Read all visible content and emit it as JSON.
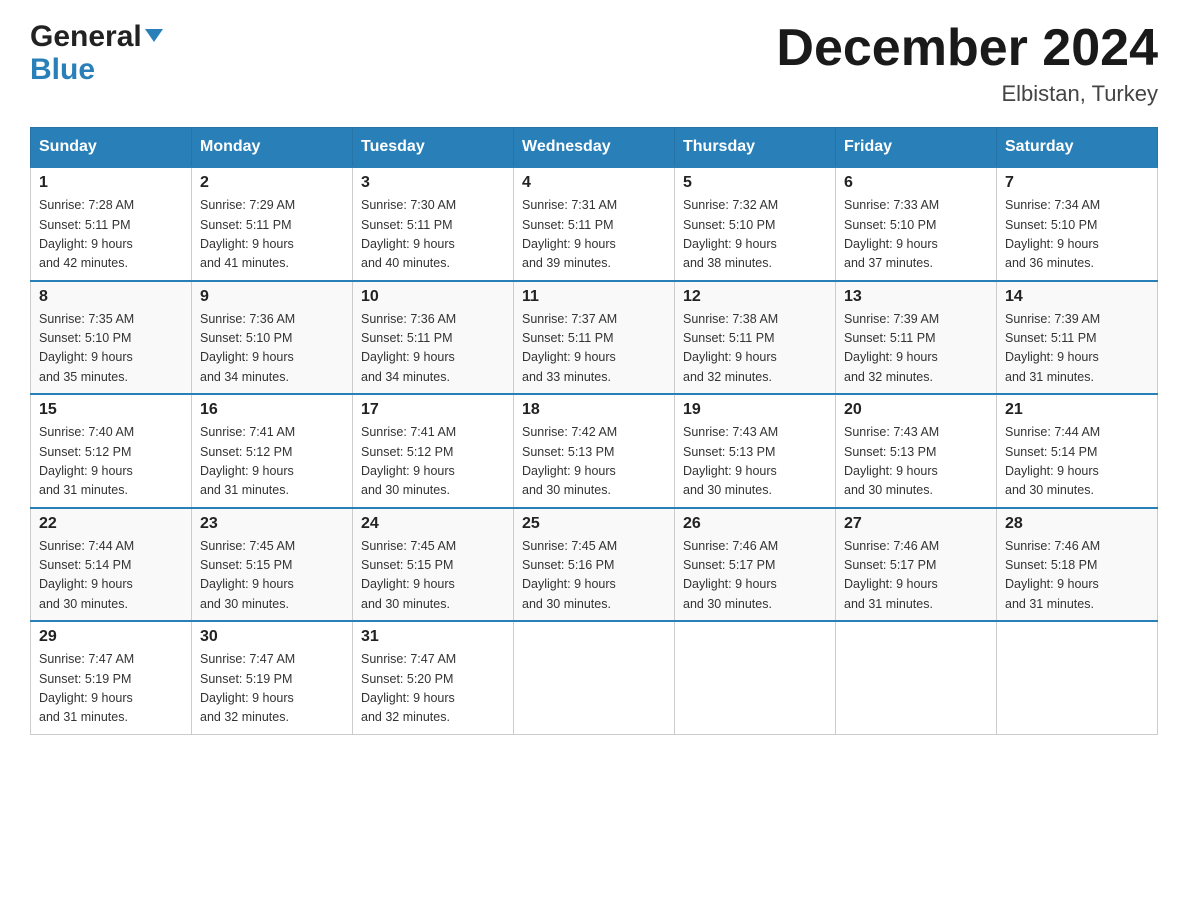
{
  "header": {
    "logo_line1": "General",
    "logo_line2": "Blue",
    "month_title": "December 2024",
    "location": "Elbistan, Turkey"
  },
  "days_of_week": [
    "Sunday",
    "Monday",
    "Tuesday",
    "Wednesday",
    "Thursday",
    "Friday",
    "Saturday"
  ],
  "weeks": [
    [
      {
        "day": "1",
        "sunrise": "7:28 AM",
        "sunset": "5:11 PM",
        "daylight": "9 hours and 42 minutes."
      },
      {
        "day": "2",
        "sunrise": "7:29 AM",
        "sunset": "5:11 PM",
        "daylight": "9 hours and 41 minutes."
      },
      {
        "day": "3",
        "sunrise": "7:30 AM",
        "sunset": "5:11 PM",
        "daylight": "9 hours and 40 minutes."
      },
      {
        "day": "4",
        "sunrise": "7:31 AM",
        "sunset": "5:11 PM",
        "daylight": "9 hours and 39 minutes."
      },
      {
        "day": "5",
        "sunrise": "7:32 AM",
        "sunset": "5:10 PM",
        "daylight": "9 hours and 38 minutes."
      },
      {
        "day": "6",
        "sunrise": "7:33 AM",
        "sunset": "5:10 PM",
        "daylight": "9 hours and 37 minutes."
      },
      {
        "day": "7",
        "sunrise": "7:34 AM",
        "sunset": "5:10 PM",
        "daylight": "9 hours and 36 minutes."
      }
    ],
    [
      {
        "day": "8",
        "sunrise": "7:35 AM",
        "sunset": "5:10 PM",
        "daylight": "9 hours and 35 minutes."
      },
      {
        "day": "9",
        "sunrise": "7:36 AM",
        "sunset": "5:10 PM",
        "daylight": "9 hours and 34 minutes."
      },
      {
        "day": "10",
        "sunrise": "7:36 AM",
        "sunset": "5:11 PM",
        "daylight": "9 hours and 34 minutes."
      },
      {
        "day": "11",
        "sunrise": "7:37 AM",
        "sunset": "5:11 PM",
        "daylight": "9 hours and 33 minutes."
      },
      {
        "day": "12",
        "sunrise": "7:38 AM",
        "sunset": "5:11 PM",
        "daylight": "9 hours and 32 minutes."
      },
      {
        "day": "13",
        "sunrise": "7:39 AM",
        "sunset": "5:11 PM",
        "daylight": "9 hours and 32 minutes."
      },
      {
        "day": "14",
        "sunrise": "7:39 AM",
        "sunset": "5:11 PM",
        "daylight": "9 hours and 31 minutes."
      }
    ],
    [
      {
        "day": "15",
        "sunrise": "7:40 AM",
        "sunset": "5:12 PM",
        "daylight": "9 hours and 31 minutes."
      },
      {
        "day": "16",
        "sunrise": "7:41 AM",
        "sunset": "5:12 PM",
        "daylight": "9 hours and 31 minutes."
      },
      {
        "day": "17",
        "sunrise": "7:41 AM",
        "sunset": "5:12 PM",
        "daylight": "9 hours and 30 minutes."
      },
      {
        "day": "18",
        "sunrise": "7:42 AM",
        "sunset": "5:13 PM",
        "daylight": "9 hours and 30 minutes."
      },
      {
        "day": "19",
        "sunrise": "7:43 AM",
        "sunset": "5:13 PM",
        "daylight": "9 hours and 30 minutes."
      },
      {
        "day": "20",
        "sunrise": "7:43 AM",
        "sunset": "5:13 PM",
        "daylight": "9 hours and 30 minutes."
      },
      {
        "day": "21",
        "sunrise": "7:44 AM",
        "sunset": "5:14 PM",
        "daylight": "9 hours and 30 minutes."
      }
    ],
    [
      {
        "day": "22",
        "sunrise": "7:44 AM",
        "sunset": "5:14 PM",
        "daylight": "9 hours and 30 minutes."
      },
      {
        "day": "23",
        "sunrise": "7:45 AM",
        "sunset": "5:15 PM",
        "daylight": "9 hours and 30 minutes."
      },
      {
        "day": "24",
        "sunrise": "7:45 AM",
        "sunset": "5:15 PM",
        "daylight": "9 hours and 30 minutes."
      },
      {
        "day": "25",
        "sunrise": "7:45 AM",
        "sunset": "5:16 PM",
        "daylight": "9 hours and 30 minutes."
      },
      {
        "day": "26",
        "sunrise": "7:46 AM",
        "sunset": "5:17 PM",
        "daylight": "9 hours and 30 minutes."
      },
      {
        "day": "27",
        "sunrise": "7:46 AM",
        "sunset": "5:17 PM",
        "daylight": "9 hours and 31 minutes."
      },
      {
        "day": "28",
        "sunrise": "7:46 AM",
        "sunset": "5:18 PM",
        "daylight": "9 hours and 31 minutes."
      }
    ],
    [
      {
        "day": "29",
        "sunrise": "7:47 AM",
        "sunset": "5:19 PM",
        "daylight": "9 hours and 31 minutes."
      },
      {
        "day": "30",
        "sunrise": "7:47 AM",
        "sunset": "5:19 PM",
        "daylight": "9 hours and 32 minutes."
      },
      {
        "day": "31",
        "sunrise": "7:47 AM",
        "sunset": "5:20 PM",
        "daylight": "9 hours and 32 minutes."
      },
      {
        "day": "",
        "sunrise": "",
        "sunset": "",
        "daylight": ""
      },
      {
        "day": "",
        "sunrise": "",
        "sunset": "",
        "daylight": ""
      },
      {
        "day": "",
        "sunrise": "",
        "sunset": "",
        "daylight": ""
      },
      {
        "day": "",
        "sunrise": "",
        "sunset": "",
        "daylight": ""
      }
    ]
  ],
  "labels": {
    "sunrise": "Sunrise:",
    "sunset": "Sunset:",
    "daylight": "Daylight:"
  }
}
